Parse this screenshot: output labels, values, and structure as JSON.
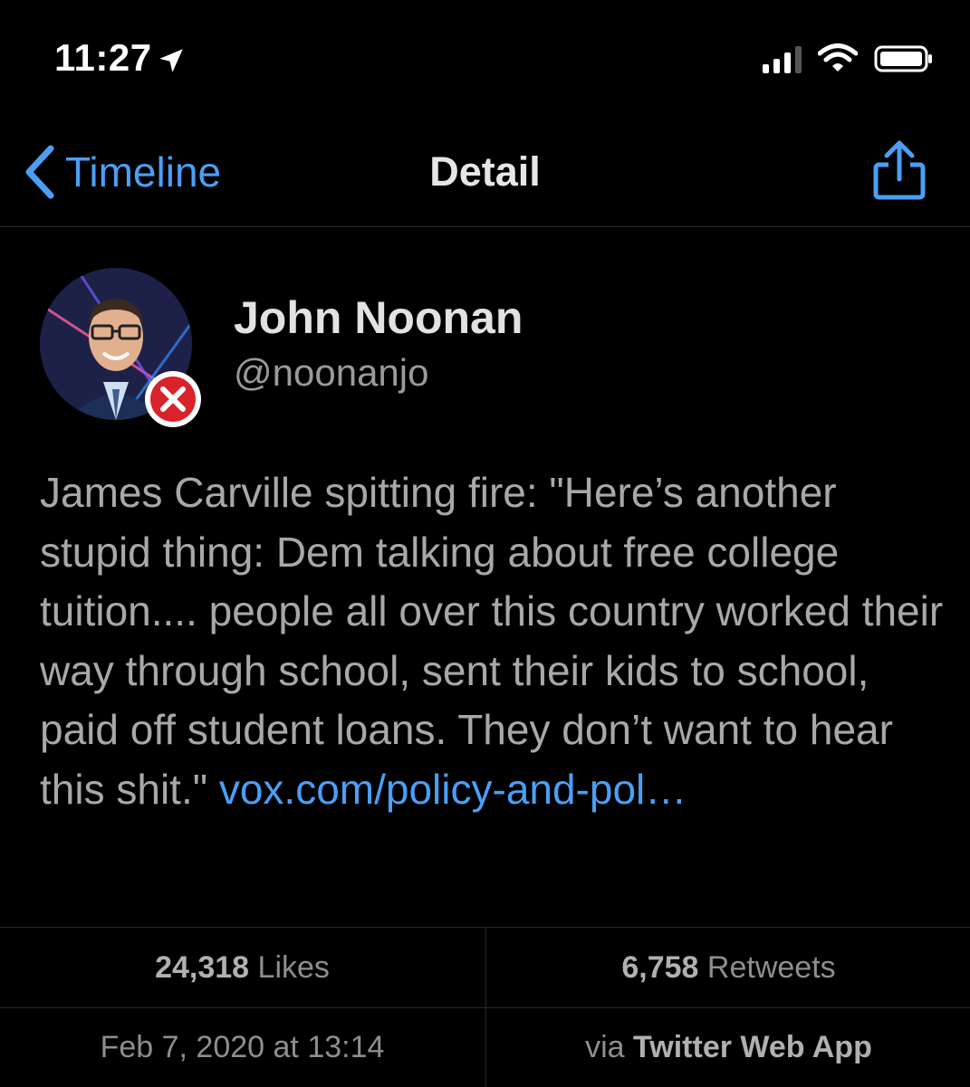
{
  "status_bar": {
    "time": "11:27",
    "icons": [
      "location-arrow-icon",
      "cellular-signal-icon",
      "wifi-icon",
      "battery-icon"
    ]
  },
  "nav": {
    "back_label": "Timeline",
    "title": "Detail",
    "accent_color": "#4a9ff5"
  },
  "tweet": {
    "author_name": "John Noonan",
    "author_handle": "@noonanjo",
    "text": "James Carville spitting fire: \"Here’s another stupid thing: Dem talking about free college tuition.... people all over this country worked their way through school, sent their kids to school, paid off student loans. They don’t want to hear this shit.\" ",
    "link_text": "vox.com/policy-and-pol…",
    "likes_count": "24,318",
    "likes_label": "Likes",
    "retweets_count": "6,758",
    "retweets_label": "Retweets",
    "timestamp": "Feb 7, 2020 at 13:14",
    "via_prefix": "via",
    "source": "Twitter Web App"
  }
}
